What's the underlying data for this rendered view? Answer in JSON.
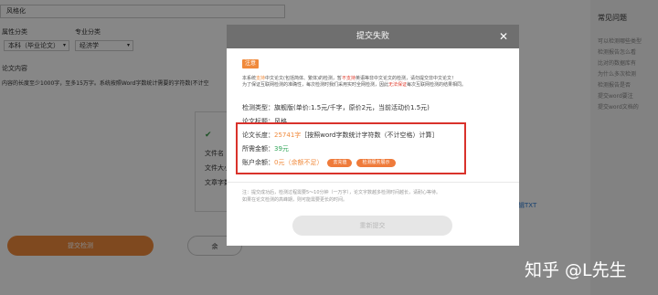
{
  "background": {
    "title_value": "风格化",
    "section1_label": "属性分类",
    "section1_value": "本科（毕业论文）",
    "section2_label": "专业分类",
    "section2_value": "经济学",
    "content_label": "论文内容",
    "content_hint": "内容的长度至少1000字，至多15万字。系统按照Word字数统计需要的字符数(不计空",
    "panel_lines": [
      "文件名",
      "文件大小",
      "文章字数"
    ],
    "submit_label": "提交检测",
    "next_label": "余",
    "right_link": "编辑TXT"
  },
  "sidebar": {
    "title": "常见问题",
    "lines": [
      "可以检测哪些类型",
      "检测报告怎么看",
      "比对的数据库有",
      "为什么多次检测",
      "检测报告是否",
      "提交word要注",
      "提交word文档的"
    ]
  },
  "modal": {
    "title": "提交失败",
    "close_symbol": "✕",
    "badge": "注意",
    "note1_a": "本系统",
    "note1_b": "支持",
    "note1_c": "中文论文(包括简体、繁体)的检测，暂",
    "note1_d": "不支持",
    "note1_e": "英语等非中文论文的检测，请勿提交非中文论文！",
    "note2_a": "为了保证互联网检测的准确性，每次检测时我们采用实时全网检测，因此",
    "note2_b": "无法保证",
    "note2_c": "每次互联网检测的结果相同。",
    "type_line": "检测类型：旗舰版(单价:1.5元/千字，原价2元，当前活动价1.5元)",
    "paper_title_label": "论文标题：",
    "paper_title_value": "风格",
    "length_label": "论文长度：",
    "length_value": "25741字",
    "length_note": "［按照word字数统计字符数（不计空格）计算］",
    "cost_label": "所需金额：",
    "cost_value": "39元",
    "balance_label": "账户余额：",
    "balance_value": "0元",
    "balance_note": "（余额不足）",
    "recharge_button": "去充值",
    "coupon_button": "检测服务展示",
    "footnote1": "注：提交成功后，检测过程需要5～10分钟（一万字），论文字数越多检测时间越长，请耐心等待。",
    "footnote2": "如果在论文检测的高峰期，则可能需要更长的时间。",
    "resubmit": "重新提交"
  },
  "watermark": "知乎 @L先生",
  "colors": {
    "accent_orange": "#ef7b3b",
    "alert_red": "#d9322b",
    "cost_green": "#33a65a"
  }
}
